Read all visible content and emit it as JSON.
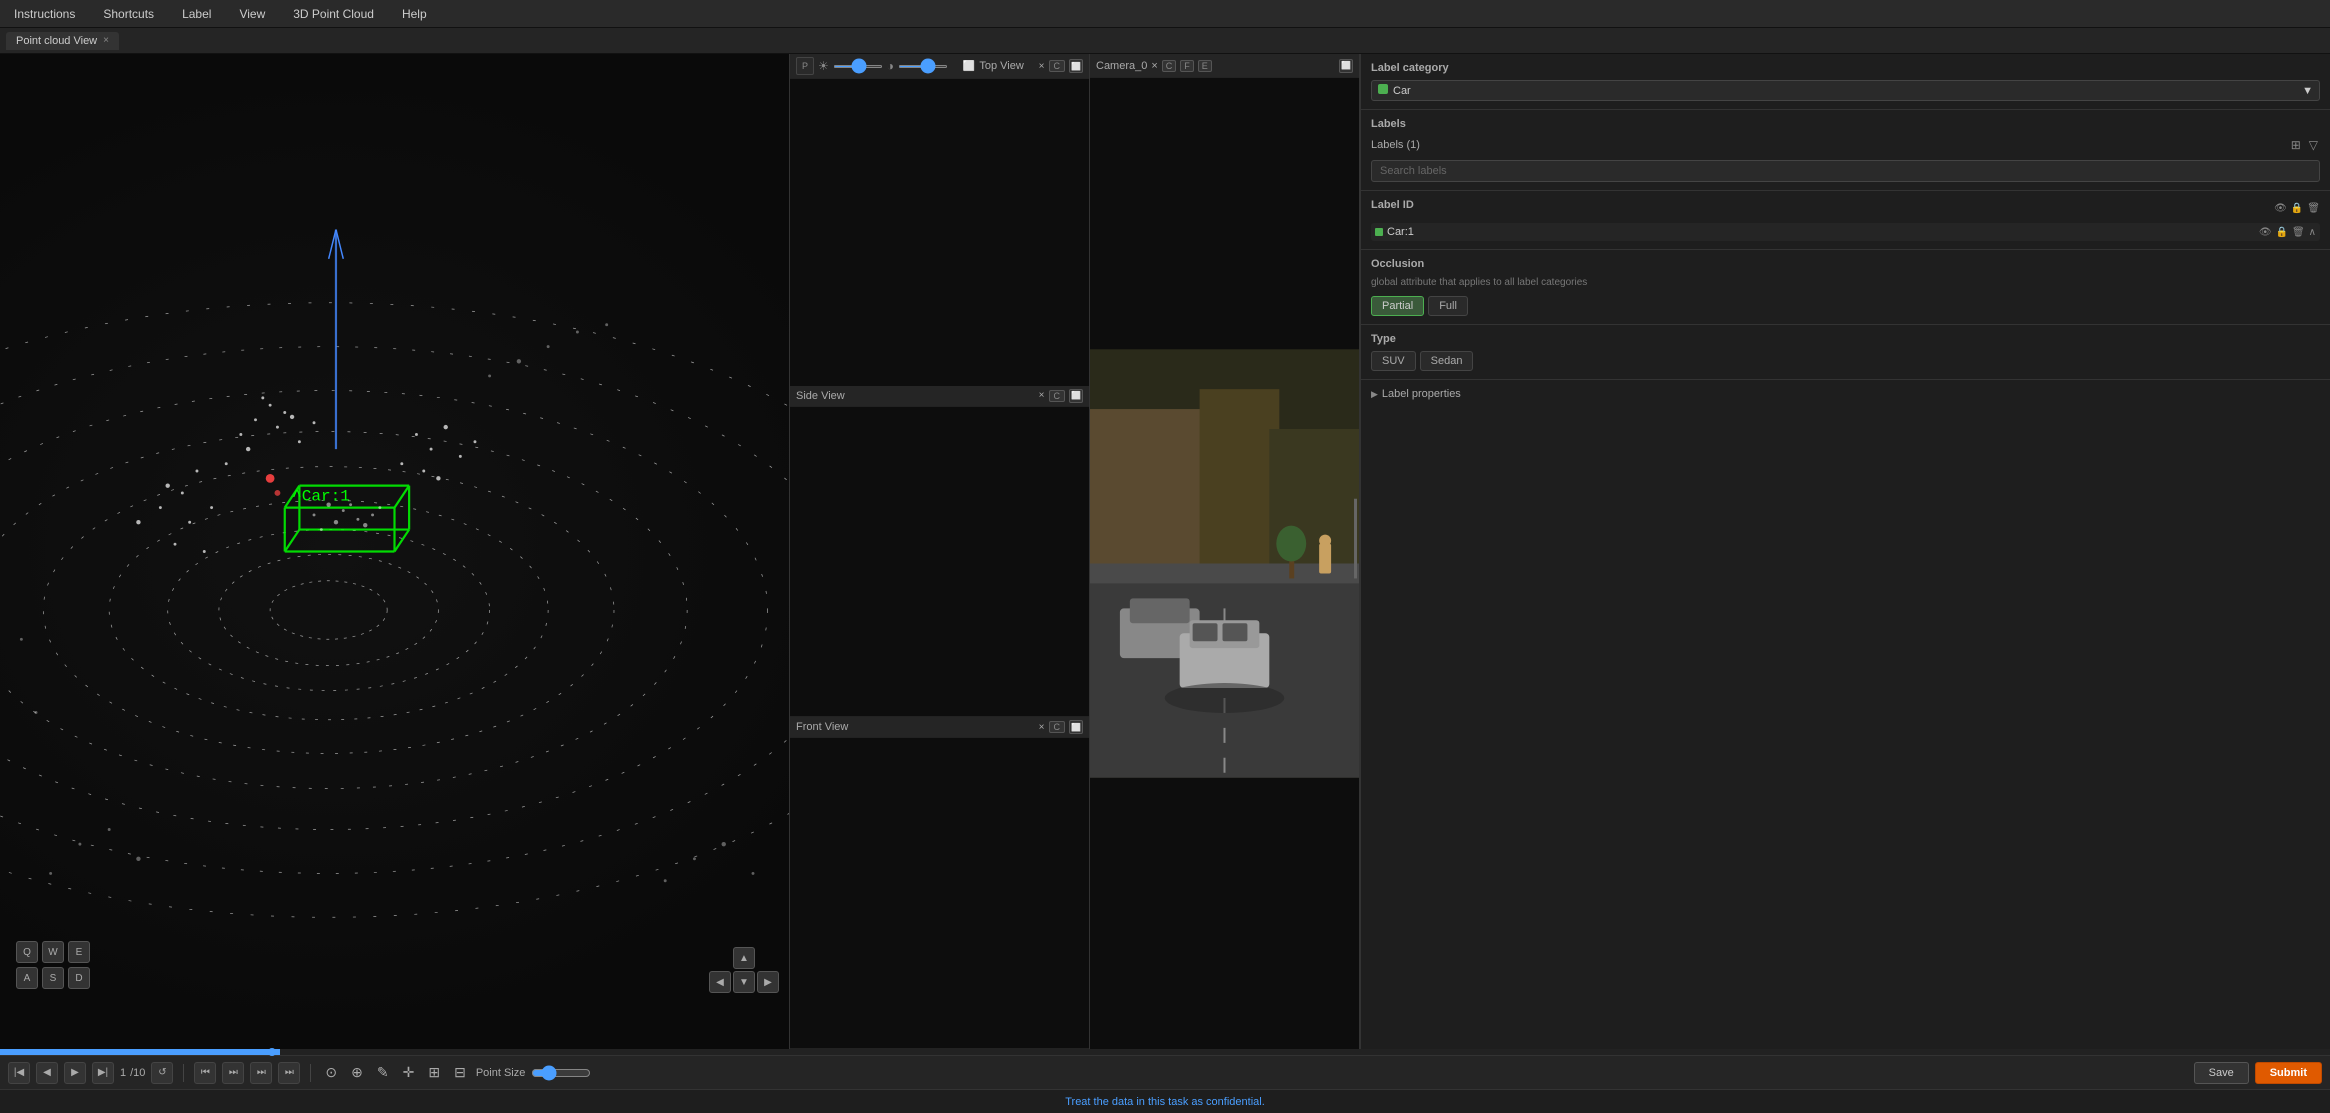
{
  "menu": {
    "items": [
      "Instructions",
      "Shortcuts",
      "Label",
      "View",
      "3D Point Cloud",
      "Help"
    ]
  },
  "tabs": {
    "main_tab": "Point cloud View",
    "close_x": "×"
  },
  "views": {
    "top_view": {
      "label": "Top View",
      "badge": "C",
      "close": "×"
    },
    "side_view": {
      "label": "Side View",
      "badge": "C",
      "close": "×"
    },
    "front_view": {
      "label": "Front View",
      "badge": "C",
      "close": "×"
    },
    "camera": {
      "label": "Camera_0",
      "badges": [
        "C",
        "F",
        "E"
      ],
      "close": "×"
    }
  },
  "keyboard": {
    "row1": [
      "Q",
      "W",
      "E"
    ],
    "row2": [
      "A",
      "S",
      "D"
    ]
  },
  "labels_panel": {
    "label_category_title": "Label category",
    "category_value": "Car",
    "labels_title": "Labels",
    "labels_count": "Labels (1)",
    "search_placeholder": "Search labels",
    "label_id_title": "Label ID",
    "label_item": "Car:1",
    "occlusion_title": "Occlusion",
    "occlusion_desc": "global attribute that applies to all label categories",
    "partial_btn": "Partial",
    "full_btn": "Full",
    "type_title": "Type",
    "suv_btn": "SUV",
    "sedan_btn": "Sedan",
    "label_props": "Label properties"
  },
  "toolbar": {
    "frame_current": "1",
    "frame_total": "/10",
    "point_size_label": "Point Size",
    "save_label": "Save",
    "submit_label": "Submit"
  },
  "status_bar": {
    "message": "Treat the data in this task as confidential."
  },
  "view_controls": {
    "brightness_icon": "☀",
    "contrast_icon": "◑"
  },
  "annotation": {
    "car_label": "^Car:1"
  }
}
